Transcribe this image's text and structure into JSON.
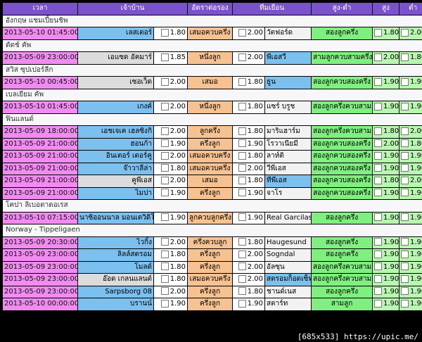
{
  "headers": [
    "เวลา",
    "เจ้าบ้าน",
    "อัตราต่อรอง",
    "ทีมเยือน",
    "สูง-ต่ำ",
    "สูง",
    "ต่ำ"
  ],
  "watermark": "[685x533] https://upic.me/",
  "rows": [
    {
      "league": "อังกฤษ แชมเปี้ยนชิพ"
    },
    {
      "time": "2013-05-10 01:45:00",
      "home": "เลสเตอร์",
      "ho": "1.80",
      "hcp": "เสมอควบครึ่ง",
      "ao": "2.00",
      "away": "วัตฟอร์ด",
      "fav": "home",
      "ou": "สองลูกครึ่ง",
      "over": "1.80",
      "under": "2.00"
    },
    {
      "league": "ดัตช์ คัพ"
    },
    {
      "time": "2013-05-09 23:00:00",
      "home": "เอแซด อัคมาร์",
      "ho": "1.85",
      "hcp": "หนึ่งลูก",
      "ao": "2.00",
      "away": "พีเอสวี",
      "fav": "away",
      "ou": "สามลูกควบสามครึ่ง",
      "over": "2.00",
      "under": "1.80"
    },
    {
      "league": "สวิส ซุปเปอร์ลีก"
    },
    {
      "time": "2013-05-10 00:45:00",
      "home": "เซอเว็ต",
      "ho": "2.00",
      "hcp": "เสมอ",
      "ao": "1.80",
      "away": "ธูน",
      "fav": "away",
      "ou": "สองลูกควบสองครึ่ง",
      "over": "1.90",
      "under": "1.90"
    },
    {
      "league": "เบลเยียม คัพ"
    },
    {
      "time": "2013-05-10 01:45:00",
      "home": "เกงค์",
      "ho": "2.00",
      "hcp": "หนึ่งลูก",
      "ao": "1.80",
      "away": "แซร์ บรูช",
      "fav": "home",
      "ou": "สองลูกครึ่งควบสาม",
      "over": "1.90",
      "under": "1.90"
    },
    {
      "league": "ฟินแลนด์"
    },
    {
      "time": "2013-05-09 18:00:00",
      "home": "เอชเจเค เฮลซิงกิ",
      "ho": "2.00",
      "hcp": "ลูกครึ่ง",
      "ao": "1.80",
      "away": "มาริแฮาร์ม",
      "fav": "home",
      "ou": "สองลูกครึ่งควบสาม",
      "over": "1.80",
      "under": "2.00"
    },
    {
      "time": "2013-05-09 21:00:00",
      "home": "ฮอนก้า",
      "ho": "1.90",
      "hcp": "ครึ่งลูก",
      "ao": "1.90",
      "away": "โรวาเนียมี",
      "fav": "home",
      "ou": "สองลูกควบสองครึ่ง",
      "over": "2.00",
      "under": "1.80"
    },
    {
      "time": "2013-05-09 21:00:00",
      "home": "อินเตอร์ เตอร์คู",
      "ho": "2.00",
      "hcp": "เสมอควบครึ่ง",
      "ao": "1.80",
      "away": "ลาห์ติ",
      "fav": "home",
      "ou": "สองลูกควบสองครึ่ง",
      "over": "1.90",
      "under": "1.90"
    },
    {
      "time": "2013-05-09 21:00:00",
      "home": "จ๊าวาลีล่า",
      "ho": "1.80",
      "hcp": "เสมอควบครึ่ง",
      "ao": "2.00",
      "away": "วีพีเอส",
      "fav": "home",
      "ou": "สองลูกควบสองครึ่ง",
      "over": "1.90",
      "under": "1.90"
    },
    {
      "time": "2013-05-09 21:00:00",
      "home": "คูพีเอส",
      "ho": "2.00",
      "hcp": "เสมอ",
      "ao": "1.80",
      "away": "ทีพีเอส",
      "fav": "away",
      "ou": "สองลูกควบสองครึ่ง",
      "over": "1.80",
      "under": "2.00"
    },
    {
      "time": "2013-05-09 21:00:00",
      "home": "ไมปา",
      "ho": "1.90",
      "hcp": "ครึ่งลูก",
      "ao": "1.90",
      "away": "จาโร",
      "fav": "home",
      "ou": "สองลูกควบสองครึ่ง",
      "over": "1.90",
      "under": "1.90"
    },
    {
      "league": "โคปา ลิเบอตาดอเรส"
    },
    {
      "time": "2013-05-10 07:15:00",
      "home": "นาซิออนนาล มอนเตวิดิโอ",
      "ho": "1.90",
      "hcp": "ลูกควบลูกครึ่ง",
      "ao": "1.90",
      "away": "Real Garcilaso",
      "fav": "home",
      "ou": "สองลูกครึ่ง",
      "over": "1.90",
      "under": "1.90"
    },
    {
      "league": "Norway - Tippeligaen"
    },
    {
      "time": "2013-05-09 20:30:00",
      "home": "ไวกิ้ง",
      "ho": "2.00",
      "hcp": "ครึ่งควบลูก",
      "ao": "1.80",
      "away": "Haugesund",
      "fav": "home",
      "ou": "สองลูกครึ่ง",
      "over": "1.90",
      "under": "1.90"
    },
    {
      "time": "2013-05-09 23:00:00",
      "home": "ลิลล์สตรอม",
      "ho": "1.80",
      "hcp": "ครึ่งลูก",
      "ao": "2.00",
      "away": "Sogndal",
      "fav": "home",
      "ou": "สองลูกครึ่ง",
      "over": "1.90",
      "under": "1.90"
    },
    {
      "time": "2013-05-09 23:00:00",
      "home": "โมลด์",
      "ho": "1.80",
      "hcp": "ครึ่งลูก",
      "ao": "2.00",
      "away": "อัลซุน",
      "fav": "home",
      "ou": "สองลูกครึ่งควบสาม",
      "over": "1.90",
      "under": "1.90"
    },
    {
      "time": "2013-05-09 23:00:00",
      "home": "อ๊อด เกลนแลนด์",
      "ho": "1.80",
      "hcp": "เสมอควบครึ่ง",
      "ao": "2.00",
      "away": "สตรอมก็อดเซ็ท",
      "fav": "away",
      "ou": "สองลูกครึ่งควบสาม",
      "over": "1.90",
      "under": "1.90"
    },
    {
      "time": "2013-05-09 23:00:00",
      "home": "Sarpsborg 08",
      "ho": "2.00",
      "hcp": "ครึ่งลูก",
      "ao": "1.80",
      "away": "ชานด์เนส",
      "fav": "home",
      "ou": "สองลูกครึ่ง",
      "over": "1.90",
      "under": "1.90"
    },
    {
      "time": "2013-05-10 00:00:00",
      "home": "บรานน์",
      "ho": "1.90",
      "hcp": "ครึ่งลูก",
      "ao": "1.90",
      "away": "สตาร์ท",
      "fav": "home",
      "ou": "สามลูก",
      "over": "1.90",
      "under": "1.90"
    }
  ]
}
